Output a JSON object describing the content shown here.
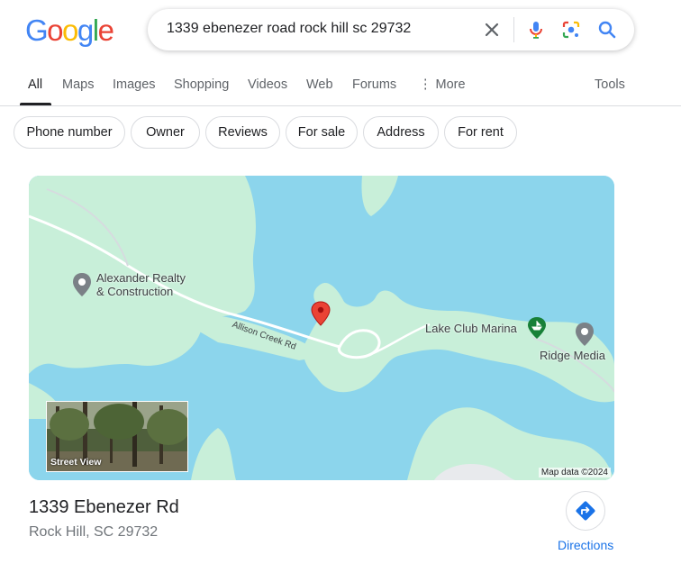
{
  "logo": {
    "letters": [
      "G",
      "o",
      "o",
      "g",
      "l",
      "e"
    ],
    "colors": [
      "#4285F4",
      "#EA4335",
      "#FBBC05",
      "#4285F4",
      "#34A853",
      "#EA4335"
    ]
  },
  "search": {
    "query": "1339 ebenezer road rock hill sc 29732"
  },
  "tabs": [
    {
      "label": "All"
    },
    {
      "label": "Maps"
    },
    {
      "label": "Images"
    },
    {
      "label": "Shopping"
    },
    {
      "label": "Videos"
    },
    {
      "label": "Web"
    },
    {
      "label": "Forums"
    },
    {
      "label": "More"
    }
  ],
  "tools_label": "Tools",
  "chips": [
    "Phone number",
    "Owner",
    "Reviews",
    "For sale",
    "Address",
    "For rent"
  ],
  "map": {
    "places": {
      "alexander_line1": "Alexander Realty",
      "alexander_line2": "& Construction",
      "marina": "Lake Club Marina",
      "ridge": "Ridge Media"
    },
    "road": "Allison Creek Rd",
    "street_view_label": "Street View",
    "map_data": "Map data ©2024",
    "colors": {
      "water": "#8cd5ec",
      "land": "#c8efd9",
      "pin": "#ea4335",
      "poi": "#188038"
    }
  },
  "result": {
    "title": "1339 Ebenezer Rd",
    "subtitle": "Rock Hill, SC 29732",
    "directions_label": "Directions"
  }
}
